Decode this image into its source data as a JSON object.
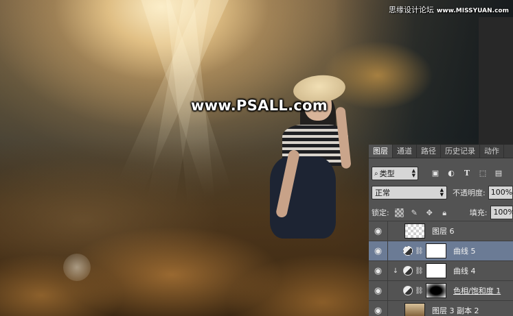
{
  "watermark": "www.PSALL.com",
  "site_credit": {
    "cn": "思缘设计论坛",
    "domain": "www.MISSYUAN.com"
  },
  "layers_panel": {
    "tabs": [
      {
        "label": "图层",
        "active": true
      },
      {
        "label": "通道",
        "active": false
      },
      {
        "label": "路径",
        "active": false
      },
      {
        "label": "历史记录",
        "active": false
      },
      {
        "label": "动作",
        "active": false
      }
    ],
    "kind_filter": {
      "lead_icon": "search-icon",
      "value": "类型"
    },
    "filter_icons": [
      "image-icon",
      "adjustment-icon",
      "type-icon",
      "shape-icon",
      "smart-object-icon"
    ],
    "blend_mode": "正常",
    "opacity_label": "不透明度:",
    "opacity_value": "100%",
    "lock_label": "锁定:",
    "lock_icons": [
      "lock-transparent-icon",
      "lock-brush-icon",
      "lock-move-icon",
      "lock-all-icon"
    ],
    "fill_label": "填充:",
    "fill_value": "100%",
    "layers": [
      {
        "name": "图层 6",
        "thumb": "transparent",
        "adjustment": false,
        "clipped": false,
        "mask": false,
        "selected": false
      },
      {
        "name": "曲线 5",
        "thumb": "white",
        "adjustment": true,
        "clipped": false,
        "mask": true,
        "selected": true
      },
      {
        "name": "曲线 4",
        "thumb": "white",
        "adjustment": true,
        "clipped": true,
        "mask": true,
        "selected": false
      },
      {
        "name": "色相/饱和度 1",
        "thumb": "gradient",
        "adjustment": true,
        "clipped": false,
        "mask": true,
        "selected": false
      },
      {
        "name": "图层 3 副本 2",
        "thumb": "photo",
        "adjustment": false,
        "clipped": false,
        "mask": false,
        "selected": false
      }
    ]
  }
}
